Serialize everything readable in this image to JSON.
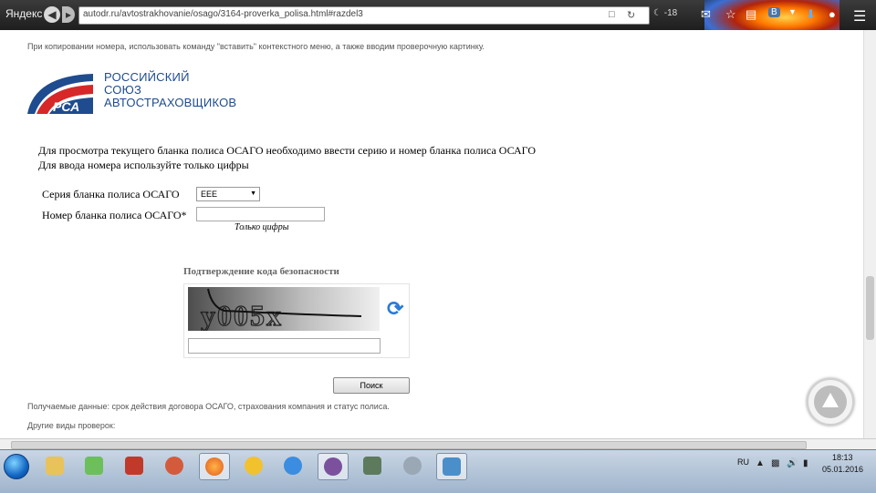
{
  "browser": {
    "brand": "Яндекс",
    "url": "autodr.ru/avtostrakhovanie/osago/3164-proverka_polisa.html#razdel3",
    "weather": "-18",
    "profile_badge": "B"
  },
  "page": {
    "copy_note": "При копировании номера, использовать команду \"вставить\" контекстного меню, а также вводим проверочную картинку.",
    "logo": {
      "mark": "РСА",
      "line1": "РОССИЙСКИЙ",
      "line2": "СОЮЗ",
      "line3": "АВТОСТРАХОВЩИКОВ"
    },
    "intro_line1": "Для просмотра текущего бланка полиса ОСАГО необходимо ввести серию и номер бланка полиса ОСАГО",
    "intro_line2": "Для ввода номера используйте только цифры",
    "series_label": "Серия бланка полиса ОСАГО",
    "series_value": "ЕЕЕ",
    "number_label": "Номер бланка полиса ОСАГО*",
    "number_value": "",
    "digits_hint": "Только цифры",
    "captcha_title": "Подтверждение кода безопасности",
    "captcha_text": "у005х",
    "captcha_input_value": "",
    "search_button": "Поиск",
    "result_note": "Получаемые данные: срок действия договора ОСАГО, страхования компания и статус полиса.",
    "other_note": "Другие виды проверок:"
  },
  "taskbar": {
    "lang": "RU",
    "time": "18:13",
    "date": "05.01.2016"
  }
}
